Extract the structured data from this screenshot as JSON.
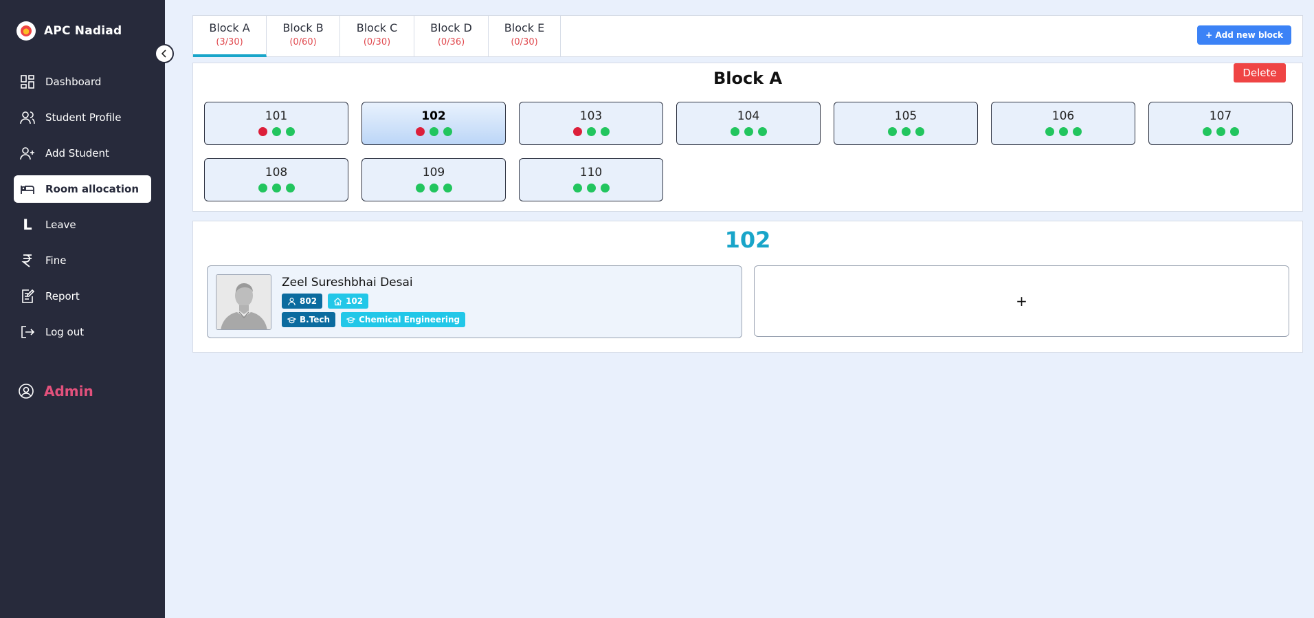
{
  "sidebar": {
    "brand": "APC Nadiad",
    "items": [
      {
        "label": "Dashboard",
        "icon": "dashboard-icon"
      },
      {
        "label": "Student Profile",
        "icon": "users-icon"
      },
      {
        "label": "Add Student",
        "icon": "user-plus-icon"
      },
      {
        "label": "Room allocation",
        "icon": "bed-icon",
        "active": true
      },
      {
        "label": "Leave",
        "icon": "leave-L-icon"
      },
      {
        "label": "Fine",
        "icon": "rupee-icon"
      },
      {
        "label": "Report",
        "icon": "report-edit-icon"
      },
      {
        "label": "Log out",
        "icon": "logout-icon"
      }
    ],
    "user_role": "Admin"
  },
  "tabs": [
    {
      "name": "Block A",
      "count": "(3/30)",
      "active": true
    },
    {
      "name": "Block B",
      "count": "(0/60)"
    },
    {
      "name": "Block C",
      "count": "(0/30)"
    },
    {
      "name": "Block D",
      "count": "(0/36)"
    },
    {
      "name": "Block E",
      "count": "(0/30)"
    }
  ],
  "add_block_label": "+ Add new block",
  "block": {
    "title": "Block A",
    "delete_label": "Delete",
    "rooms": [
      {
        "number": "101",
        "occupied": 1,
        "capacity": 3
      },
      {
        "number": "102",
        "occupied": 1,
        "capacity": 3,
        "selected": true
      },
      {
        "number": "103",
        "occupied": 1,
        "capacity": 3
      },
      {
        "number": "104",
        "occupied": 0,
        "capacity": 3
      },
      {
        "number": "105",
        "occupied": 0,
        "capacity": 3
      },
      {
        "number": "106",
        "occupied": 0,
        "capacity": 3
      },
      {
        "number": "107",
        "occupied": 0,
        "capacity": 3
      },
      {
        "number": "108",
        "occupied": 0,
        "capacity": 3
      },
      {
        "number": "109",
        "occupied": 0,
        "capacity": 3
      },
      {
        "number": "110",
        "occupied": 0,
        "capacity": 3
      }
    ]
  },
  "room_detail": {
    "title": "102",
    "student": {
      "name": "Zeel Sureshbhai Desai",
      "id": "802",
      "room": "102",
      "degree": "B.Tech",
      "branch": "Chemical Engineering"
    },
    "add_label": "+"
  },
  "colors": {
    "sidebar_bg": "#272a3b",
    "page_bg": "#e9f0fc",
    "accent": "#19a5c9",
    "available_dot": "#22c55e",
    "occupied_dot": "#dc1f3a",
    "admin": "#e2517c",
    "delete": "#ef4444",
    "primary_button": "#3b82f6"
  }
}
